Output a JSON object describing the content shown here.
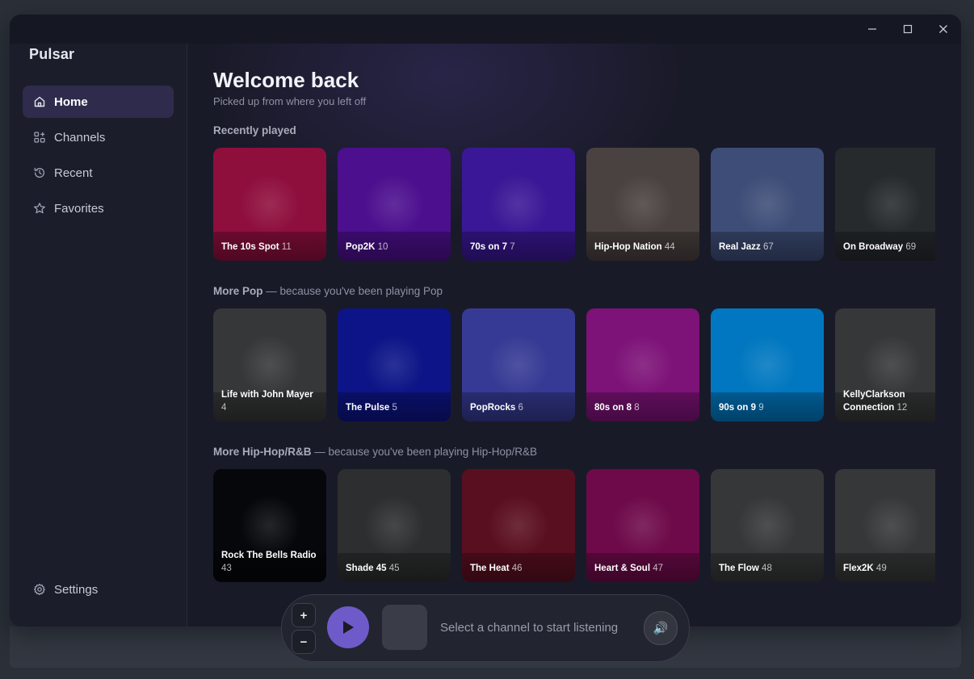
{
  "app": {
    "name": "Pulsar"
  },
  "window_controls": {
    "minimize_icon": "minimize-icon",
    "maximize_icon": "maximize-icon",
    "close_icon": "close-icon"
  },
  "sidebar": {
    "items": [
      {
        "label": "Home",
        "icon": "home-icon",
        "active": true
      },
      {
        "label": "Channels",
        "icon": "channels-icon",
        "active": false
      },
      {
        "label": "Recent",
        "icon": "history-icon",
        "active": false
      },
      {
        "label": "Favorites",
        "icon": "star-icon",
        "active": false
      }
    ],
    "settings": {
      "label": "Settings",
      "icon": "gear-icon"
    }
  },
  "main": {
    "title": "Welcome back",
    "subtitle": "Picked up from where you left off",
    "sections": [
      {
        "title": "Recently played",
        "reason": "",
        "cards": [
          {
            "name": "The 10s Spot",
            "number": "11",
            "color": "#8e0e3c"
          },
          {
            "name": "Pop2K",
            "number": "10",
            "color": "#4c0f8e"
          },
          {
            "name": "70s on 7",
            "number": "7",
            "color": "#3a1796"
          },
          {
            "name": "Hip-Hop Nation",
            "number": "44",
            "color": "#4a4240"
          },
          {
            "name": "Real Jazz",
            "number": "67",
            "color": "#3d4d77"
          },
          {
            "name": "On Broadway",
            "number": "69",
            "color": "#262a2d"
          }
        ]
      },
      {
        "title": "More Pop",
        "reason": " — because you've been playing Pop",
        "cards": [
          {
            "name": "Life with John Mayer",
            "number": "4",
            "color": "#363738"
          },
          {
            "name": "The Pulse",
            "number": "5",
            "color": "#0c1487"
          },
          {
            "name": "PopRocks",
            "number": "6",
            "color": "#363a94"
          },
          {
            "name": "80s on 8",
            "number": "8",
            "color": "#7d1278"
          },
          {
            "name": "90s on 9",
            "number": "9",
            "color": "#0077c0"
          },
          {
            "name": "KellyClarkson Connection",
            "number": "12",
            "color": "#363738"
          }
        ]
      },
      {
        "title": "More Hip-Hop/R&B",
        "reason": " — because you've been playing Hip-Hop/R&B",
        "cards": [
          {
            "name": "Rock The Bells Radio",
            "number": "43",
            "color": "#05070a"
          },
          {
            "name": "Shade 45",
            "number": "45",
            "color": "#2d2e2f"
          },
          {
            "name": "The Heat",
            "number": "46",
            "color": "#5a0f20"
          },
          {
            "name": "Heart & Soul",
            "number": "47",
            "color": "#6e0a4a"
          },
          {
            "name": "The Flow",
            "number": "48",
            "color": "#363738"
          },
          {
            "name": "Flex2K",
            "number": "49",
            "color": "#363738"
          }
        ]
      }
    ]
  },
  "player": {
    "zoom_in_label": "+",
    "zoom_out_label": "−",
    "play_icon": "play-icon",
    "status": "Select a channel to start listening",
    "volume_icon": "volume-icon",
    "volume_glyph": "🔊"
  }
}
